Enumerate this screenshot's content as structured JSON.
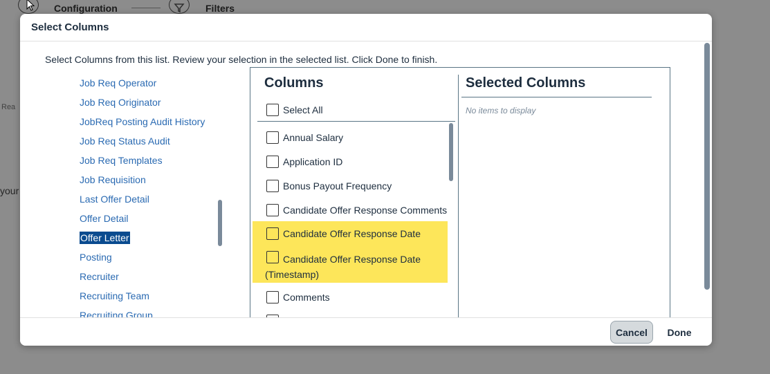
{
  "background": {
    "toolbar": {
      "configuration_label": "Configuration",
      "filters_label": "Filters"
    },
    "muted_text_left": "Rea",
    "muted_text_your": "your"
  },
  "dialog": {
    "title": "Select Columns",
    "instruction": "Select Columns from this list. Review your selection in the selected list. Click Done to finish.",
    "left_list": [
      {
        "label": "Job Req Operator",
        "selected": false
      },
      {
        "label": "Job Req Originator",
        "selected": false
      },
      {
        "label": "JobReq Posting Audit History",
        "selected": false
      },
      {
        "label": "Job Req Status Audit",
        "selected": false
      },
      {
        "label": "Job Req Templates",
        "selected": false
      },
      {
        "label": "Job Requisition",
        "selected": false
      },
      {
        "label": "Last Offer Detail",
        "selected": false
      },
      {
        "label": "Offer Detail",
        "selected": false
      },
      {
        "label": "Offer Letter",
        "selected": true
      },
      {
        "label": "Posting",
        "selected": false
      },
      {
        "label": "Recruiter",
        "selected": false
      },
      {
        "label": "Recruiting Team",
        "selected": false
      },
      {
        "label": "Recruiting Group",
        "selected": false
      }
    ],
    "columns": {
      "title": "Columns",
      "select_all_label": "Select All",
      "items": [
        {
          "label": "Annual Salary",
          "checked": false,
          "highlighted": false
        },
        {
          "label": "Application ID",
          "checked": false,
          "highlighted": false
        },
        {
          "label": "Bonus Payout Frequency",
          "checked": false,
          "highlighted": false
        },
        {
          "label": "Candidate Offer Response Comments",
          "checked": false,
          "highlighted": false
        },
        {
          "label": "Candidate Offer Response Date",
          "checked": false,
          "highlighted": true
        },
        {
          "label": "Candidate Offer Response Date (Timestamp)",
          "checked": false,
          "highlighted": true
        },
        {
          "label": "Comments",
          "checked": false,
          "highlighted": false
        }
      ]
    },
    "selected_columns": {
      "title": "Selected Columns",
      "empty_text": "No items to display"
    },
    "footer": {
      "cancel_label": "Cancel",
      "done_label": "Done"
    }
  },
  "colors": {
    "link": "#2a6ab2",
    "highlight": "#fde65a",
    "selected_bg": "#0a4b8f"
  }
}
